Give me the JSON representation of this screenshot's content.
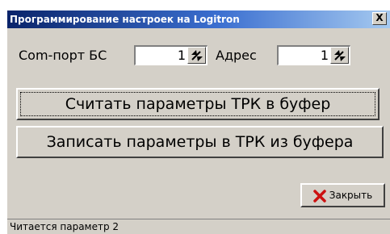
{
  "window": {
    "title": "Программирование настроек на Logitron",
    "close_glyph": "X"
  },
  "settings": {
    "port_label": "Com-порт БС",
    "port_value": "1",
    "address_label": "Адрес",
    "address_value": "1"
  },
  "buttons": {
    "read_label": "Считать параметры ТРК в буфер",
    "write_label": "Записать параметры в ТРК из буфера",
    "close_label": "Закрыть"
  },
  "status": {
    "text": "Читается параметр 2"
  },
  "icons": {
    "spin": "spin-arrows-icon",
    "close": "red-x-icon"
  },
  "colors": {
    "title_gradient_start": "#0a246a",
    "title_gradient_end": "#a6caf0",
    "face": "#d4d0c8",
    "close_x": "#cc1111"
  }
}
